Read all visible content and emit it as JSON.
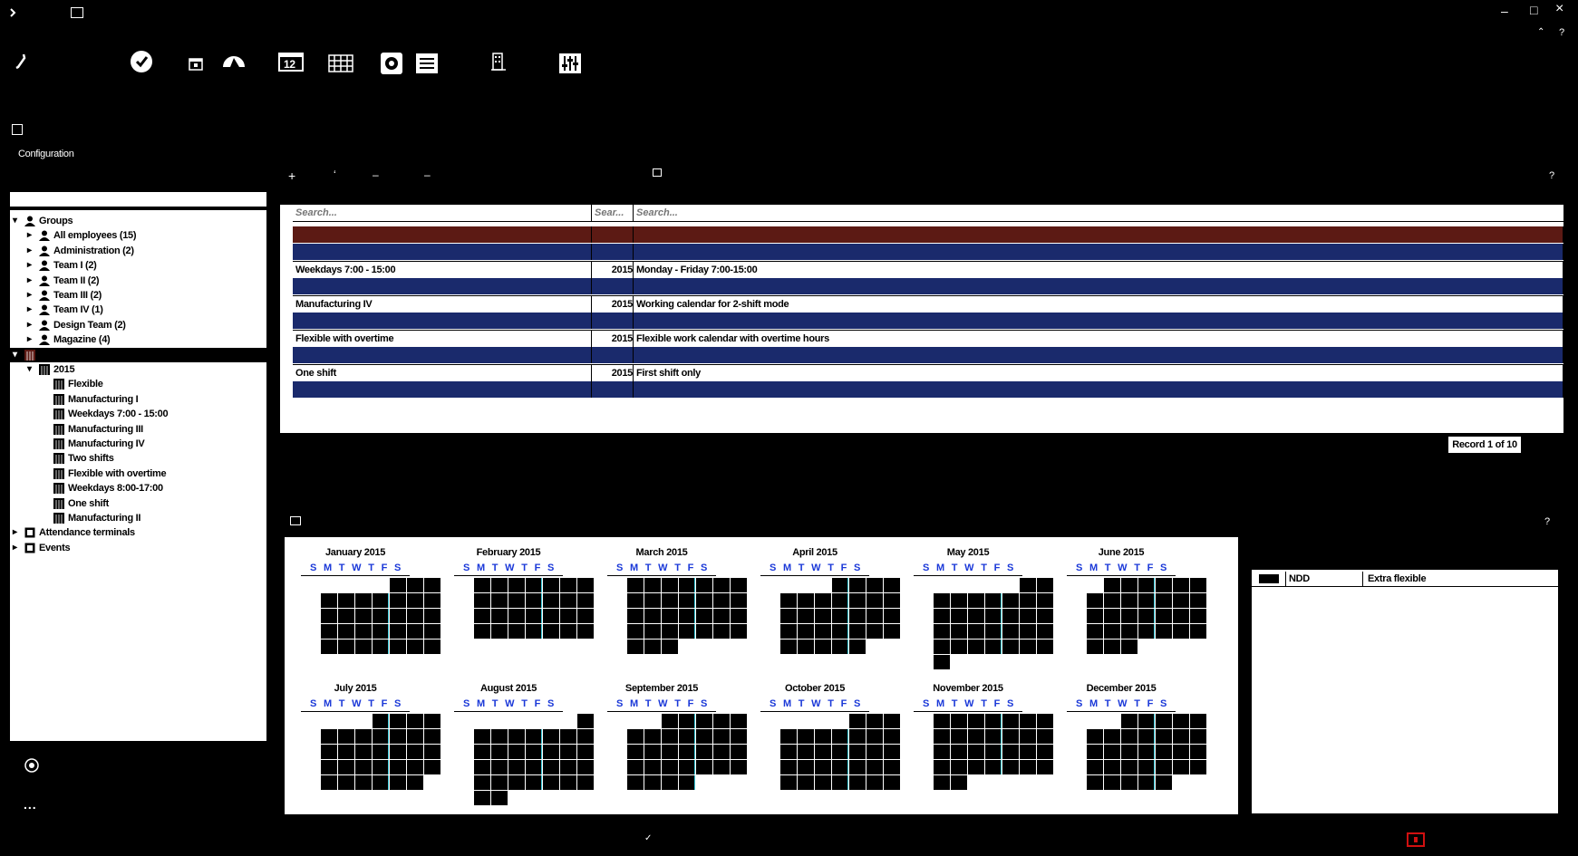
{
  "titlebar": {
    "app_icon": "app-icon",
    "title": "",
    "minimize": "–",
    "maximize": "□",
    "close": "×"
  },
  "toolbar": [
    "wrench-icon",
    "person-icon",
    "clock-icon",
    "calendar-small-icon",
    "gauge-icon",
    "calendar-12-icon",
    "grid-icon",
    "gear-icon",
    "list-icon",
    "building-icon",
    "sliders-icon"
  ],
  "toolbar_calendar_day": "12",
  "sidebar": {
    "title": "Configuration",
    "tree": [
      {
        "label": "Groups",
        "level": 0,
        "arrow": "down",
        "icon": "group-icon"
      },
      {
        "label": "All employees (15)",
        "level": 1,
        "arrow": "right",
        "icon": "person-icon"
      },
      {
        "label": "Administration (2)",
        "level": 1,
        "arrow": "right",
        "icon": "person-icon"
      },
      {
        "label": "Team I (2)",
        "level": 1,
        "arrow": "right",
        "icon": "person-icon"
      },
      {
        "label": "Team II (2)",
        "level": 1,
        "arrow": "right",
        "icon": "person-icon"
      },
      {
        "label": "Team III (2)",
        "level": 1,
        "arrow": "right",
        "icon": "person-icon"
      },
      {
        "label": "Team IV (1)",
        "level": 1,
        "arrow": "right",
        "icon": "person-icon"
      },
      {
        "label": "Design Team (2)",
        "level": 1,
        "arrow": "right",
        "icon": "person-icon"
      },
      {
        "label": "Magazine (4)",
        "level": 1,
        "arrow": "right",
        "icon": "person-icon"
      },
      {
        "label": "",
        "level": 0,
        "arrow": "down",
        "icon": "calendar-icon",
        "selected": true
      },
      {
        "label": "2015",
        "level": 1,
        "arrow": "down",
        "icon": "calendar-icon"
      },
      {
        "label": "Flexible",
        "level": 2,
        "arrow": "",
        "icon": "calendar-icon"
      },
      {
        "label": "Manufacturing I",
        "level": 2,
        "arrow": "",
        "icon": "calendar-icon"
      },
      {
        "label": "Weekdays 7:00 - 15:00",
        "level": 2,
        "arrow": "",
        "icon": "calendar-icon"
      },
      {
        "label": "Manufacturing III",
        "level": 2,
        "arrow": "",
        "icon": "calendar-icon"
      },
      {
        "label": "Manufacturing IV",
        "level": 2,
        "arrow": "",
        "icon": "calendar-icon"
      },
      {
        "label": "Two shifts",
        "level": 2,
        "arrow": "",
        "icon": "calendar-icon"
      },
      {
        "label": "Flexible with overtime",
        "level": 2,
        "arrow": "",
        "icon": "calendar-icon"
      },
      {
        "label": "Weekdays 8:00-17:00",
        "level": 2,
        "arrow": "",
        "icon": "calendar-icon"
      },
      {
        "label": "One shift",
        "level": 2,
        "arrow": "",
        "icon": "calendar-icon"
      },
      {
        "label": "Manufacturing II",
        "level": 2,
        "arrow": "",
        "icon": "calendar-icon"
      },
      {
        "label": "Attendance terminals",
        "level": 0,
        "arrow": "right",
        "icon": "terminal-icon"
      },
      {
        "label": "Events",
        "level": 0,
        "arrow": "right",
        "icon": "events-icon"
      }
    ],
    "bottom_icons": [
      "refresh-icon"
    ],
    "more": "..."
  },
  "toolbar2": {
    "add": "+",
    "remove": "–",
    "remove2": "–",
    "help": "?"
  },
  "table": {
    "search_placeholders": [
      "Search...",
      "Sear...",
      "Search..."
    ],
    "rows": [
      {
        "name": "",
        "year": "",
        "desc": "",
        "style": "red"
      },
      {
        "name": "",
        "year": "",
        "desc": "",
        "style": "blue"
      },
      {
        "name": "Weekdays 7:00 - 15:00",
        "year": "2015",
        "desc": "Monday - Friday 7:00-15:00",
        "style": "white"
      },
      {
        "name": "",
        "year": "",
        "desc": "",
        "style": "blue"
      },
      {
        "name": "Manufacturing IV",
        "year": "2015",
        "desc": "Working calendar for 2-shift mode",
        "style": "white"
      },
      {
        "name": "",
        "year": "",
        "desc": "",
        "style": "blue"
      },
      {
        "name": "Flexible with overtime",
        "year": "2015",
        "desc": "Flexible work calendar with overtime hours",
        "style": "white"
      },
      {
        "name": "",
        "year": "",
        "desc": "",
        "style": "blue"
      },
      {
        "name": "One shift",
        "year": "2015",
        "desc": "First shift only",
        "style": "white"
      },
      {
        "name": "",
        "year": "",
        "desc": "",
        "style": "blue"
      }
    ],
    "record_label": "Record 1 of 10"
  },
  "calendar": {
    "help": "?",
    "weekday_letters": [
      "S",
      "M",
      "T",
      "W",
      "T",
      "F",
      "S"
    ],
    "months": [
      {
        "title": "January 2015",
        "start": 4,
        "days": 31
      },
      {
        "title": "February 2015",
        "start": 0,
        "days": 28
      },
      {
        "title": "March 2015",
        "start": 0,
        "days": 31
      },
      {
        "title": "April 2015",
        "start": 3,
        "days": 30
      },
      {
        "title": "May 2015",
        "start": 5,
        "days": 31
      },
      {
        "title": "June 2015",
        "start": 1,
        "days": 30
      },
      {
        "title": "July 2015",
        "start": 3,
        "days": 31
      },
      {
        "title": "August 2015",
        "start": 6,
        "days": 31
      },
      {
        "title": "September 2015",
        "start": 2,
        "days": 30
      },
      {
        "title": "October 2015",
        "start": 4,
        "days": 31
      },
      {
        "title": "November 2015",
        "start": 0,
        "days": 30
      },
      {
        "title": "December 2015",
        "start": 2,
        "days": 31
      }
    ]
  },
  "right_panel": {
    "rows": [
      {
        "code": "NDD",
        "desc": "Extra flexible"
      }
    ]
  },
  "colors": {
    "blue_row": "#1a2a6c",
    "red_row": "#5c1a14",
    "weekday": "#1a38d8",
    "today": "#38c8d8",
    "status_red": "#d01010"
  }
}
